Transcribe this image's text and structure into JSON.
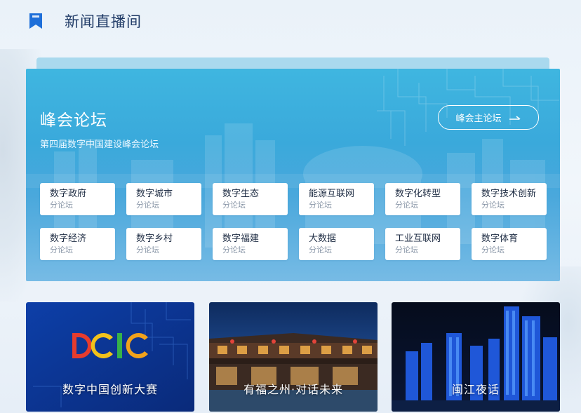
{
  "header": {
    "title": "新闻直播间",
    "logo_icon": "bookmark-icon"
  },
  "summit": {
    "title": "峰会论坛",
    "subtitle": "第四届数字中国建设峰会论坛",
    "main_forum_label": "峰会主论坛",
    "forums": [
      {
        "name": "数字政府",
        "sub": "分论坛"
      },
      {
        "name": "数字城市",
        "sub": "分论坛"
      },
      {
        "name": "数字生态",
        "sub": "分论坛"
      },
      {
        "name": "能源互联网",
        "sub": "分论坛"
      },
      {
        "name": "数字化转型",
        "sub": "分论坛"
      },
      {
        "name": "数字技术创新",
        "sub": "分论坛"
      },
      {
        "name": "数字经济",
        "sub": "分论坛"
      },
      {
        "name": "数字乡村",
        "sub": "分论坛"
      },
      {
        "name": "数字福建",
        "sub": "分论坛"
      },
      {
        "name": "大数据",
        "sub": "分论坛"
      },
      {
        "name": "工业互联网",
        "sub": "分论坛"
      },
      {
        "name": "数字体育",
        "sub": "分论坛"
      }
    ]
  },
  "promos": [
    {
      "label": "数字中国创新大赛",
      "logo_text": "DCIC"
    },
    {
      "label": "有福之州·对话未来"
    },
    {
      "label": "闽江夜话"
    }
  ],
  "colors": {
    "accent": "#1e6fd9",
    "summit_bg": "#3fb0df",
    "title_text": "#1f3a66"
  }
}
